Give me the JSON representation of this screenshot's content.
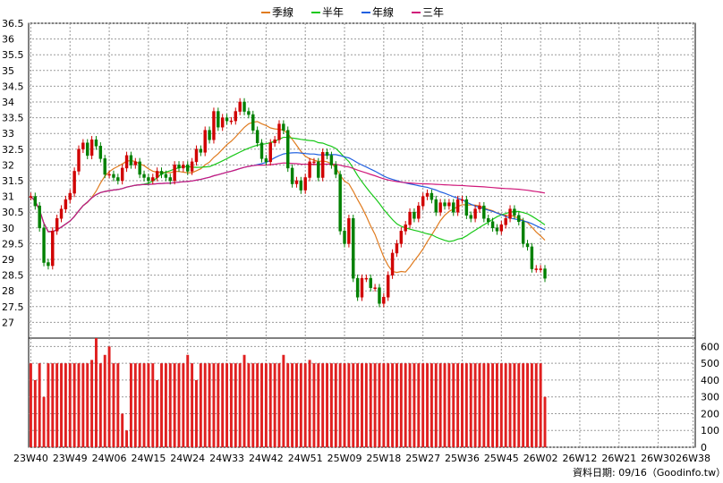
{
  "legend": {
    "items": [
      {
        "label": "季線",
        "color": "#e07b1f"
      },
      {
        "label": "半年",
        "color": "#18c818"
      },
      {
        "label": "年線",
        "color": "#2060e0"
      },
      {
        "label": "三年",
        "color": "#d0187a"
      }
    ]
  },
  "footer": {
    "source": "資料日期: 09/16（Goodinfo.tw）"
  },
  "chart_data": [
    {
      "type": "candlestick",
      "title": "",
      "ylim": [
        26.5,
        36.5
      ],
      "y_ticks": [
        27,
        27.5,
        28,
        28.5,
        29,
        29.5,
        30,
        30.5,
        31,
        31.5,
        32,
        32.5,
        33,
        33.5,
        34,
        34.5,
        35,
        35.5,
        36,
        36.5
      ],
      "x_tick_labels": [
        "23W40",
        "23W49",
        "24W06",
        "24W15",
        "24W24",
        "24W33",
        "24W42",
        "24W51",
        "25W09",
        "25W18",
        "25W27",
        "25W36",
        "25W45",
        "26W02",
        "26W12",
        "26W21",
        "26W30",
        "26W38"
      ],
      "x_tick_index": [
        0,
        9,
        18,
        27,
        36,
        45,
        54,
        63,
        72,
        81,
        90,
        99,
        108,
        117,
        126,
        135,
        144,
        152
      ],
      "n_periods": 153,
      "close": [
        31.0,
        30.7,
        30.0,
        28.9,
        28.8,
        29.9,
        30.3,
        30.6,
        30.9,
        31.1,
        31.8,
        32.5,
        32.7,
        32.3,
        32.8,
        32.6,
        32.2,
        31.7,
        31.7,
        31.6,
        31.5,
        31.9,
        32.3,
        32.0,
        32.1,
        31.7,
        31.6,
        31.5,
        31.6,
        31.8,
        31.7,
        31.6,
        31.5,
        32.0,
        31.9,
        32.0,
        31.8,
        32.1,
        32.5,
        32.4,
        33.1,
        32.8,
        33.7,
        33.2,
        33.5,
        33.4,
        33.4,
        33.7,
        34.0,
        33.7,
        33.6,
        33.1,
        32.7,
        32.2,
        32.1,
        32.7,
        32.8,
        33.3,
        33.1,
        31.9,
        31.4,
        31.5,
        31.2,
        31.6,
        32.1,
        32.1,
        31.6,
        32.4,
        32.3,
        32.0,
        31.7,
        29.9,
        29.5,
        30.3,
        28.4,
        27.8,
        28.4,
        28.4,
        28.1,
        28.1,
        27.6,
        27.8,
        28.5,
        29.2,
        29.5,
        29.9,
        30.1,
        30.5,
        30.3,
        30.7,
        31.0,
        31.1,
        30.9,
        30.5,
        30.8,
        30.7,
        30.8,
        30.5,
        30.9,
        30.9,
        30.4,
        30.3,
        30.6,
        30.7,
        30.3,
        30.2,
        30.0,
        29.9,
        30.1,
        30.3,
        30.6,
        30.4,
        30.2,
        29.5,
        29.4,
        28.7,
        28.7,
        28.7,
        28.4
      ],
      "series": [
        {
          "name": "季線"
        },
        {
          "name": "半年"
        },
        {
          "name": "年線"
        },
        {
          "name": "三年"
        }
      ]
    },
    {
      "type": "bar",
      "ylim": [
        0,
        650
      ],
      "y_ticks": [
        0,
        100,
        200,
        300,
        400,
        500,
        600
      ],
      "values": [
        500,
        400,
        500,
        300,
        500,
        500,
        500,
        500,
        500,
        500,
        500,
        500,
        500,
        500,
        520,
        650,
        500,
        550,
        600,
        500,
        500,
        200,
        100,
        500,
        500,
        500,
        500,
        500,
        500,
        400,
        500,
        500,
        500,
        500,
        500,
        500,
        550,
        500,
        400,
        500,
        500,
        500,
        500,
        500,
        500,
        500,
        500,
        500,
        500,
        550,
        500,
        500,
        500,
        500,
        500,
        500,
        500,
        500,
        550,
        500,
        500,
        500,
        500,
        500,
        520,
        500,
        500,
        500,
        500,
        500,
        500,
        500,
        500,
        500,
        500,
        500,
        500,
        500,
        500,
        500,
        500,
        500,
        500,
        500,
        500,
        500,
        500,
        500,
        500,
        500,
        500,
        500,
        500,
        500,
        500,
        500,
        500,
        500,
        500,
        500,
        500,
        500,
        500,
        500,
        500,
        500,
        500,
        500,
        500,
        500,
        500,
        500,
        500,
        500,
        500,
        500,
        500,
        500,
        300
      ]
    }
  ]
}
